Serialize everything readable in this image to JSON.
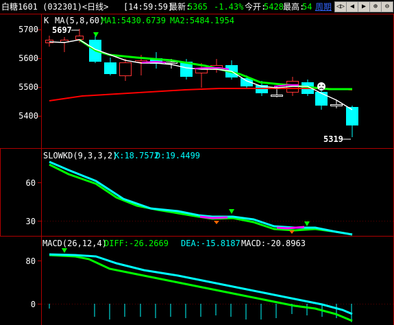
{
  "header": {
    "title": "白糖1601 (032301)<日线>",
    "time": "[14:59:59]",
    "last_label": "最新:",
    "last_value": "5365",
    "change": "-1.43%",
    "open_label": "今开:",
    "open_value": "5428",
    "high_label": "最高:",
    "high_value": "54",
    "period_label": "周期"
  },
  "nav": [
    "◁▷",
    "◀",
    "▶",
    "⊕",
    "⊖"
  ],
  "kline": {
    "legend_k": "K",
    "legend_ma": "MA(5,8,60)",
    "legend_ma1": "MA1:5430.6739",
    "legend_ma2": "MA2:5484.1954",
    "axis_labels": [
      "5700",
      "5600",
      "5500",
      "5400"
    ],
    "high_mark": "5697",
    "low_mark": "5319",
    "colors": {
      "up": "#ff3333",
      "down": "#00ffff",
      "ma1": "#ffffff",
      "ma2": "#00ff00",
      "ma3": "#ff0000",
      "highlight": "#ff00ff"
    }
  },
  "slowkd": {
    "legend_name": "SLOWKD(9,3,3,2)",
    "legend_k": "K:18.7572",
    "legend_d": "D:19.4499",
    "axis_labels": [
      "60",
      "30"
    ]
  },
  "macd": {
    "legend_name": "MACD(26,12,4)",
    "legend_diff": "DIFF:-26.2669",
    "legend_dea": "DEA:-15.8187",
    "legend_macd": "MACD:-20.8963",
    "axis_labels": [
      "80",
      "0"
    ]
  }
}
